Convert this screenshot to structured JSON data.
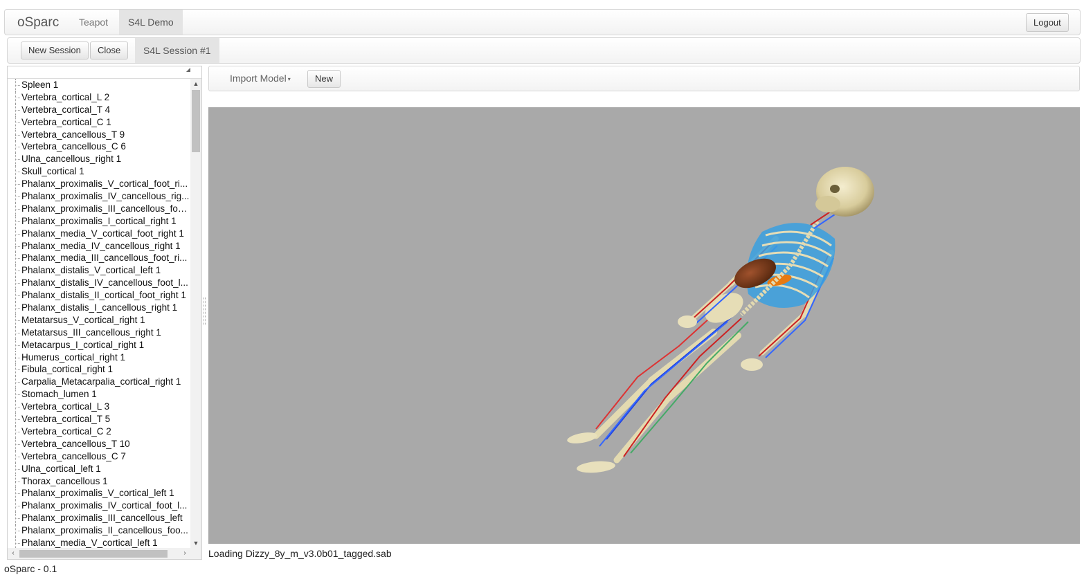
{
  "navbar": {
    "brand": "oSparc",
    "tabs": [
      {
        "label": "Teapot",
        "active": false
      },
      {
        "label": "S4L Demo",
        "active": true
      }
    ],
    "logout_label": "Logout"
  },
  "session_bar": {
    "new_session_label": "New Session",
    "close_label": "Close",
    "session_tab": "S4L Session #1"
  },
  "tree": {
    "items": [
      "Spleen 1",
      "Vertebra_cortical_L 2",
      "Vertebra_cortical_T 4",
      "Vertebra_cortical_C 1",
      "Vertebra_cancellous_T 9",
      "Vertebra_cancellous_C 6",
      "Ulna_cancellous_right 1",
      "Skull_cortical 1",
      "Phalanx_proximalis_V_cortical_foot_ri...",
      "Phalanx_proximalis_IV_cancellous_rig...",
      "Phalanx_proximalis_III_cancellous_foo...",
      "Phalanx_proximalis_I_cortical_right 1",
      "Phalanx_media_V_cortical_foot_right 1",
      "Phalanx_media_IV_cancellous_right 1",
      "Phalanx_media_III_cancellous_foot_ri...",
      "Phalanx_distalis_V_cortical_left 1",
      "Phalanx_distalis_IV_cancellous_foot_l...",
      "Phalanx_distalis_II_cortical_foot_right 1",
      "Phalanx_distalis_I_cancellous_right 1",
      "Metatarsus_V_cortical_right 1",
      "Metatarsus_III_cancellous_right 1",
      "Metacarpus_I_cortical_right 1",
      "Humerus_cortical_right 1",
      "Fibula_cortical_right 1",
      "Carpalia_Metacarpalia_cortical_right 1",
      "Stomach_lumen 1",
      "Vertebra_cortical_L 3",
      "Vertebra_cortical_T 5",
      "Vertebra_cortical_C 2",
      "Vertebra_cancellous_T 10",
      "Vertebra_cancellous_C 7",
      "Ulna_cortical_left 1",
      "Thorax_cancellous 1",
      "Phalanx_proximalis_V_cortical_left 1",
      "Phalanx_proximalis_IV_cortical_foot_l...",
      "Phalanx_proximalis_III_cancellous_left",
      "Phalanx_proximalis_II_cancellous_foo...",
      "Phalanx_media_V_cortical_left 1"
    ]
  },
  "toolbar": {
    "import_model_label": "Import Model",
    "new_label": "New"
  },
  "viewport": {
    "background": "#a9a9a9"
  },
  "status_text": "Loading Dizzy_8y_m_v3.0b01_tagged.sab",
  "footer_text": "oSparc - 0.1"
}
